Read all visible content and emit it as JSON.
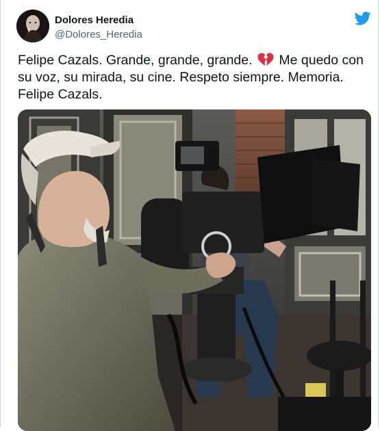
{
  "author": {
    "display_name": "Dolores Heredia",
    "handle": "@Dolores_Heredia"
  },
  "tweet": {
    "text_before_emoji": "Felipe Cazals. Grande, grande, grande.",
    "emoji": "broken-heart-icon",
    "text_after_emoji": "Me quedo con su voz, su mirada, su cine. Respeto siempre. Memoria. Felipe Cazals."
  },
  "icons": {
    "platform": "twitter-bird-icon"
  },
  "colors": {
    "brand_blue": "#1d9bf0",
    "handle_gray": "#536471",
    "text": "#0f1419",
    "heart_red": "#e0245e"
  }
}
